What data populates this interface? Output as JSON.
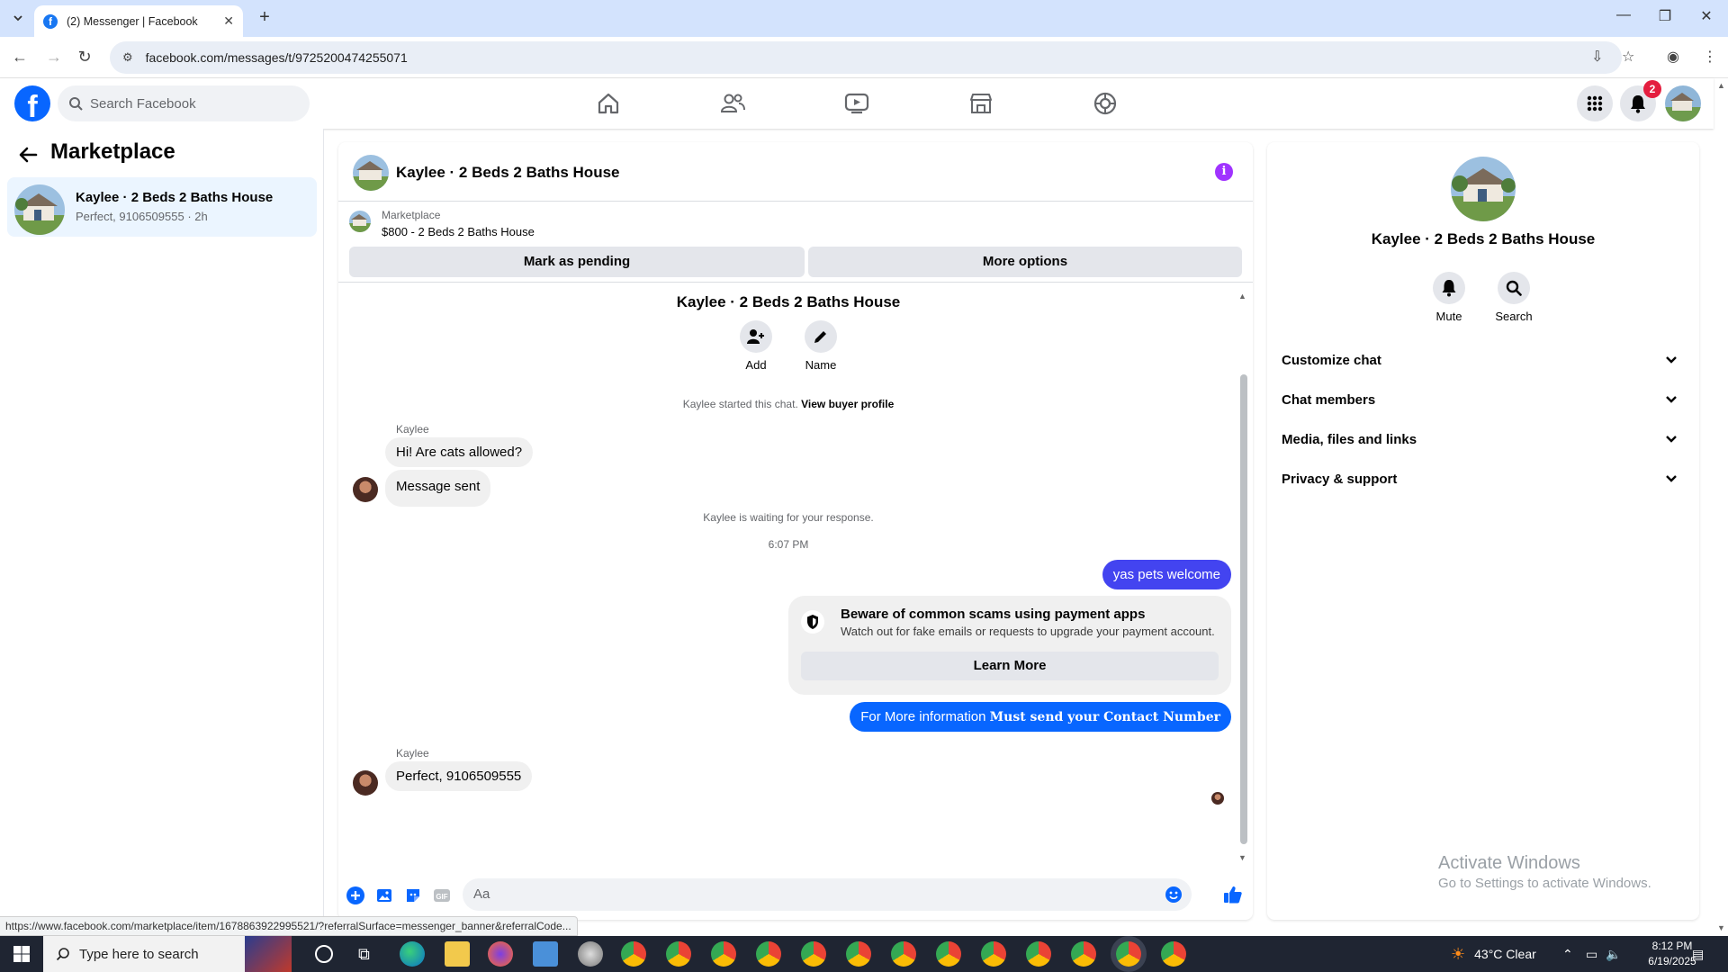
{
  "browser": {
    "tab_title": "(2) Messenger | Facebook",
    "url": "facebook.com/messages/t/9725200474255071",
    "status_url": "https://www.facebook.com/marketplace/item/1678863922995521/?referralSurface=messenger_banner&referralCode..."
  },
  "fb_header": {
    "search_placeholder": "Search Facebook",
    "notification_count": "2"
  },
  "left_panel": {
    "title": "Marketplace",
    "conversations": [
      {
        "name": "Kaylee · 2 Beds 2 Baths House",
        "preview": "Perfect, 9106509555 · 2h"
      }
    ]
  },
  "chat": {
    "header_name": "Kaylee · 2 Beds 2 Baths House",
    "marketplace_label": "Marketplace",
    "listing": "$800 - 2 Beds 2 Baths House",
    "mark_pending_label": "Mark as pending",
    "more_options_label": "More options",
    "intro_name": "Kaylee · 2 Beds 2 Baths House",
    "add_label": "Add",
    "name_label": "Name",
    "started_text": "Kaylee started this chat.",
    "view_buyer_label": "View buyer profile",
    "sender1": "Kaylee",
    "msg1": "Hi! Are cats allowed?",
    "msg2": "Message sent",
    "waiting_text": "Kaylee is waiting for your response.",
    "timestamp": "6:07 PM",
    "out1": "yas pets welcome",
    "scam_title": "Beware of common scams using payment apps",
    "scam_body": "Watch out for fake emails or requests to upgrade your payment account.",
    "learn_more_label": "Learn More",
    "out2_plain": "For More information",
    "out2_bold": "Must send your Contact Number",
    "sender2": "Kaylee",
    "msg3": "Perfect, 9106509555",
    "composer_placeholder": "Aa"
  },
  "right_panel": {
    "name": "Kaylee · 2 Beds 2 Baths House",
    "mute_label": "Mute",
    "search_label": "Search",
    "sections": [
      "Customize chat",
      "Chat members",
      "Media, files and links",
      "Privacy & support"
    ]
  },
  "watermark": {
    "line1": "Activate Windows",
    "line2": "Go to Settings to activate Windows."
  },
  "taskbar": {
    "search_placeholder": "Type here to search",
    "weather": "43°C  Clear",
    "time": "8:12 PM",
    "date": "6/19/2025"
  },
  "colors": {
    "fb_blue": "#0866ff",
    "outgoing_bubble": "#4344f0",
    "info_purple": "#a033ff",
    "badge_red": "#e41e3f"
  }
}
